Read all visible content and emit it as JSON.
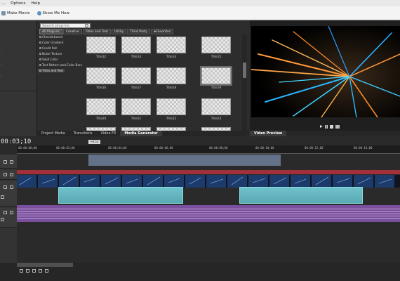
{
  "menu": [
    "...",
    "Options",
    "Help"
  ],
  "toolbar": {
    "make_movie": "Make Movie",
    "show_me_how": "Show Me How"
  },
  "media_generator": {
    "search_placeholder": "Search plug-ins",
    "categories": [
      "All Plug-ins",
      "Creative",
      "Titles and Text",
      "Utility",
      "Third Party",
      "Favorites"
    ],
    "plugins": [
      "Checkerboard",
      "Color Gradient",
      "Credit Roll",
      "Noise Texture",
      "Solid Color",
      "Test Pattern and Color Bars",
      "Titles and Text"
    ],
    "thumbnails": [
      [
        "Title12",
        "Title13",
        "Title14",
        "Title15"
      ],
      [
        "Title16",
        "Title17",
        "Title18",
        "Title19"
      ],
      [
        "Title20",
        "Title21",
        "Title22",
        "Title23"
      ]
    ],
    "selected_thumbnail": "Title19"
  },
  "tabs": [
    "Project Media",
    "Transitions",
    "Video FX",
    "Media Generator"
  ],
  "active_tab": "Media Generator",
  "preview": {
    "tab": "Video Preview"
  },
  "timeline": {
    "timecode": "00:03;10",
    "playhead": "+6;12",
    "ruler": [
      "00:00:00;00",
      "00:00:02;00",
      "00:00:04;00",
      "00:00:06;00",
      "00:00:08;00",
      "00:00:10;00",
      "00:00:12;00",
      "00:00:14;00"
    ]
  },
  "colors": {
    "red_track": "#a1303a",
    "teal_clip": "#6fc1cc",
    "audio_clip": "#7a4f9e",
    "loop_region": "#6f7f9a"
  }
}
